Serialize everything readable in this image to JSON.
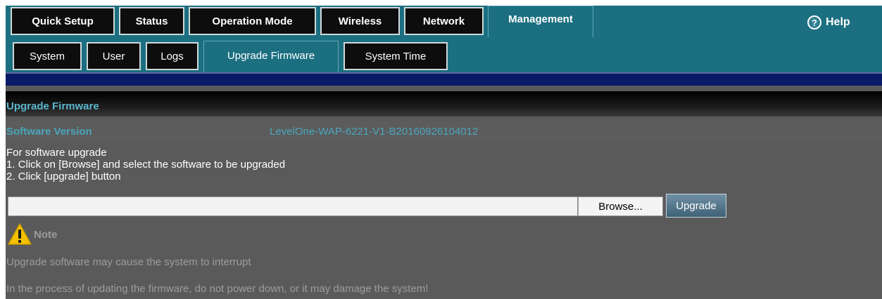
{
  "nav": {
    "tabs": [
      {
        "label": "Quick Setup"
      },
      {
        "label": "Status"
      },
      {
        "label": "Operation Mode"
      },
      {
        "label": "Wireless"
      },
      {
        "label": "Network"
      },
      {
        "label": "Management",
        "active": true
      }
    ],
    "help": {
      "icon": "help-icon",
      "label": "Help"
    }
  },
  "subnav": {
    "tabs": [
      {
        "label": "System"
      },
      {
        "label": "User"
      },
      {
        "label": "Logs"
      },
      {
        "label": "Upgrade Firmware",
        "active": true
      },
      {
        "label": "System Time"
      }
    ]
  },
  "page": {
    "title": "Upgrade Firmware",
    "software_version_label": "Software Version",
    "software_version_value": "LevelOne-WAP-6221-V1-B20160926104012",
    "instructions": [
      "For software upgrade",
      "1. Click on [Browse] and select the software to be upgraded",
      "2. Click [upgrade] button"
    ],
    "file_input_value": "",
    "browse_label": "Browse...",
    "upgrade_label": "Upgrade",
    "note_label": "Note",
    "warnings": [
      "Upgrade software may cause the system to interrupt",
      "In the process of updating the firmware, do not power down, or it may damage the system!"
    ]
  },
  "colors": {
    "nav_band": "#1b6f80",
    "tab_bg": "#0d0d0d",
    "accent_text": "#4aa6bd",
    "content_bg": "#5a5a5a",
    "warning_icon": "#f2c200"
  }
}
